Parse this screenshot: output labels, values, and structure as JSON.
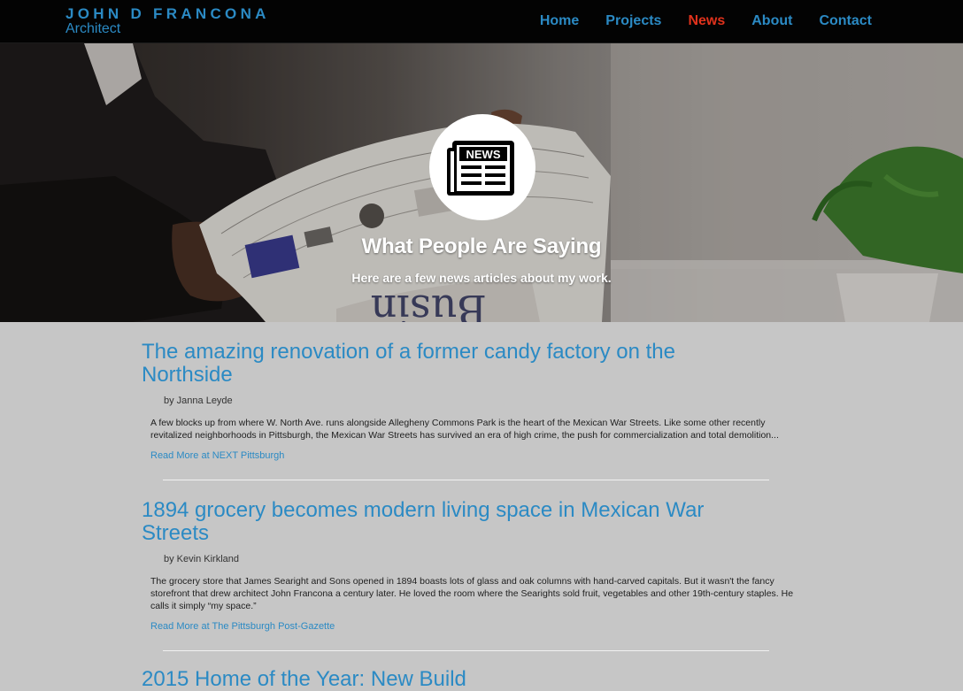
{
  "site": {
    "name": "JOHN D FRANCONA",
    "subtitle": "Architect"
  },
  "nav": {
    "items": [
      {
        "label": "Home",
        "active": false
      },
      {
        "label": "Projects",
        "active": false
      },
      {
        "label": "News",
        "active": true
      },
      {
        "label": "About",
        "active": false
      },
      {
        "label": "Contact",
        "active": false
      }
    ]
  },
  "hero": {
    "badge_icon": "newspaper-icon",
    "badge_text": "NEWS",
    "title": "What People Are Saying",
    "subtitle": "Here are a few news articles about my work."
  },
  "articles": [
    {
      "title": "The amazing renovation of a former candy factory on the Northside",
      "byline": "by Janna Leyde",
      "excerpt": "A few blocks up from where W. North Ave. runs alongside Allegheny Commons Park is the heart of the Mexican War Streets. Like some other recently revitalized neighborhoods in Pittsburgh, the Mexican War Streets has survived an era of high crime, the push for commercialization and total demolition...",
      "link": "Read More at NEXT Pittsburgh"
    },
    {
      "title": "1894 grocery becomes modern living space in Mexican War Streets",
      "byline": "by Kevin Kirkland",
      "excerpt": "The grocery store that James Searight and Sons opened in 1894 boasts lots of glass and oak columns with hand-carved capitals. But it wasn't the fancy storefront that drew architect John Francona a century later. He loved the room where the Searights sold fruit, vegetables and other 19th-century staples. He calls it simply “my space.”",
      "link": "Read More at The Pittsburgh Post-Gazette"
    },
    {
      "title": "2015 Home of the Year: New Build"
    }
  ],
  "colors": {
    "accent": "#2b8ac4",
    "active": "#e0321c",
    "header_bg": "#030303",
    "page_bg": "#c6c6c6"
  }
}
